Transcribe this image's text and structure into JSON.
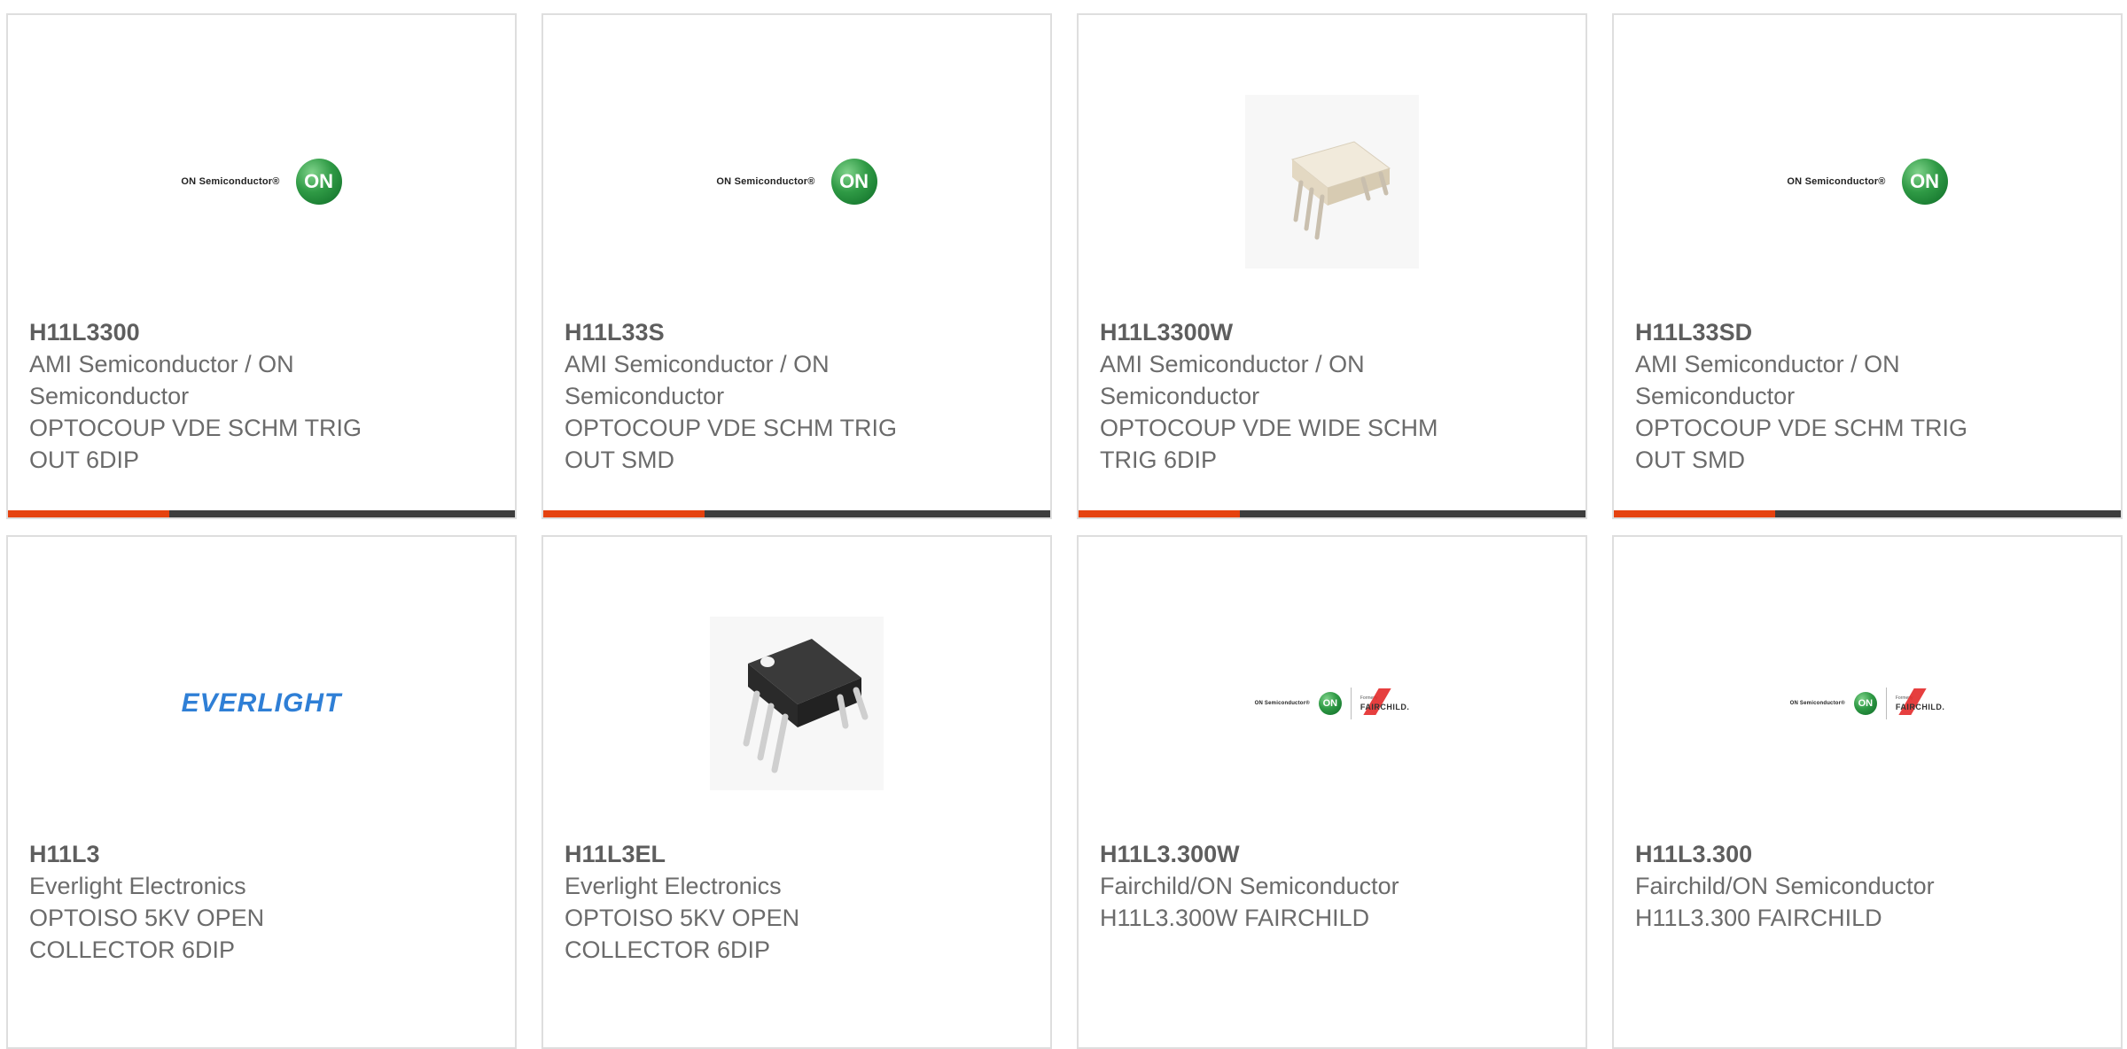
{
  "products": [
    {
      "part_number": "H11L3300",
      "manufacturer": "AMI Semiconductor / ON Semiconductor",
      "description": "OPTOCOUP VDE SCHM TRIG OUT 6DIP",
      "image": {
        "kind": "on-semiconductor-logo",
        "text": "ON Semiconductor®",
        "badge": "ON"
      }
    },
    {
      "part_number": "H11L33S",
      "manufacturer": "AMI Semiconductor / ON Semiconductor",
      "description": "OPTOCOUP VDE SCHM TRIG OUT SMD",
      "image": {
        "kind": "on-semiconductor-logo",
        "text": "ON Semiconductor®",
        "badge": "ON"
      }
    },
    {
      "part_number": "H11L3300W",
      "manufacturer": "AMI Semiconductor / ON Semiconductor",
      "description": "OPTOCOUP VDE WIDE SCHM TRIG 6DIP",
      "image": {
        "kind": "white-dip-chip-photo"
      }
    },
    {
      "part_number": "H11L33SD",
      "manufacturer": "AMI Semiconductor / ON Semiconductor",
      "description": "OPTOCOUP VDE SCHM TRIG OUT SMD",
      "image": {
        "kind": "on-semiconductor-logo",
        "text": "ON Semiconductor®",
        "badge": "ON"
      }
    },
    {
      "part_number": "H11L3",
      "manufacturer": "Everlight Electronics",
      "description": "OPTOISO 5KV OPEN COLLECTOR 6DIP",
      "image": {
        "kind": "everlight-logo",
        "text": "EVERLIGHT"
      }
    },
    {
      "part_number": "H11L3EL",
      "manufacturer": "Everlight Electronics",
      "description": "OPTOISO 5KV OPEN COLLECTOR 6DIP",
      "image": {
        "kind": "black-dip-chip-photo"
      }
    },
    {
      "part_number": "H11L3.300W",
      "manufacturer": "Fairchild/ON Semiconductor",
      "description": "H11L3.300W FAIRCHILD",
      "image": {
        "kind": "on-fairchild-logo",
        "text": "ON Semiconductor®",
        "badge": "ON",
        "formerly": "Formerly",
        "brand": "FAIRCHILD."
      }
    },
    {
      "part_number": "H11L3.300",
      "manufacturer": "Fairchild/ON Semiconductor",
      "description": "H11L3.300 FAIRCHILD",
      "image": {
        "kind": "on-fairchild-logo",
        "text": "ON Semiconductor®",
        "badge": "ON",
        "formerly": "Formerly",
        "brand": "FAIRCHILD."
      }
    }
  ],
  "colors": {
    "accent": "#e5420f",
    "bar_dark": "#3d3d3d",
    "card_border": "#dedede",
    "text": "#6b6b6b",
    "everlight_blue": "#2f7fd6",
    "on_green": "#2f9a45"
  }
}
